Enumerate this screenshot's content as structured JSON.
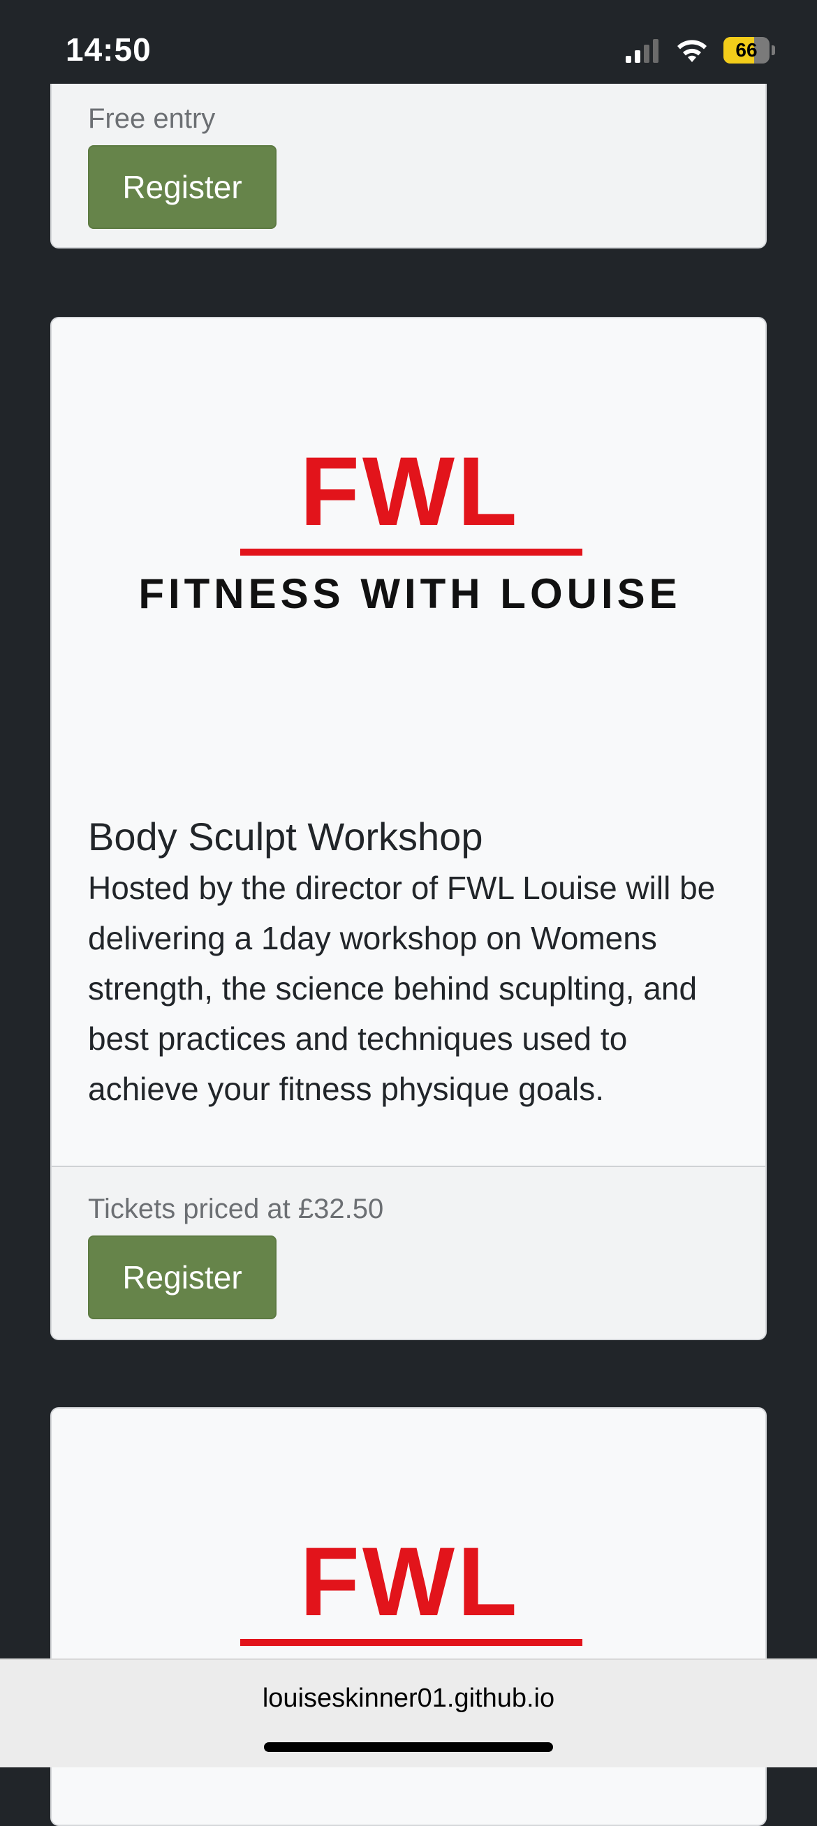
{
  "status_bar": {
    "time": "14:50",
    "battery_level": "66",
    "battery_percent": 66,
    "signal_icon": "cellular-signal-icon",
    "wifi_icon": "wifi-icon"
  },
  "cards": [
    {
      "price": "Free entry",
      "register_label": "Register"
    },
    {
      "logo_title": "FWL",
      "logo_subtitle": "FITNESS WITH LOUISE",
      "title": "Body Sculpt Workshop",
      "text": "Hosted by the director of FWL Louise will be delivering a 1day workshop on Womens strength, the science behind scuplting, and best practices and techniques used to achieve your fitness physique goals.",
      "price": "Tickets priced at £32.50",
      "register_label": "Register"
    },
    {
      "logo_title": "FWL"
    }
  ],
  "browser": {
    "url": "louiseskinner01.github.io"
  },
  "colors": {
    "page_background": "#212529",
    "card_background": "#f8f9fa",
    "button_green": "#66844a",
    "logo_red": "#e2141b"
  }
}
